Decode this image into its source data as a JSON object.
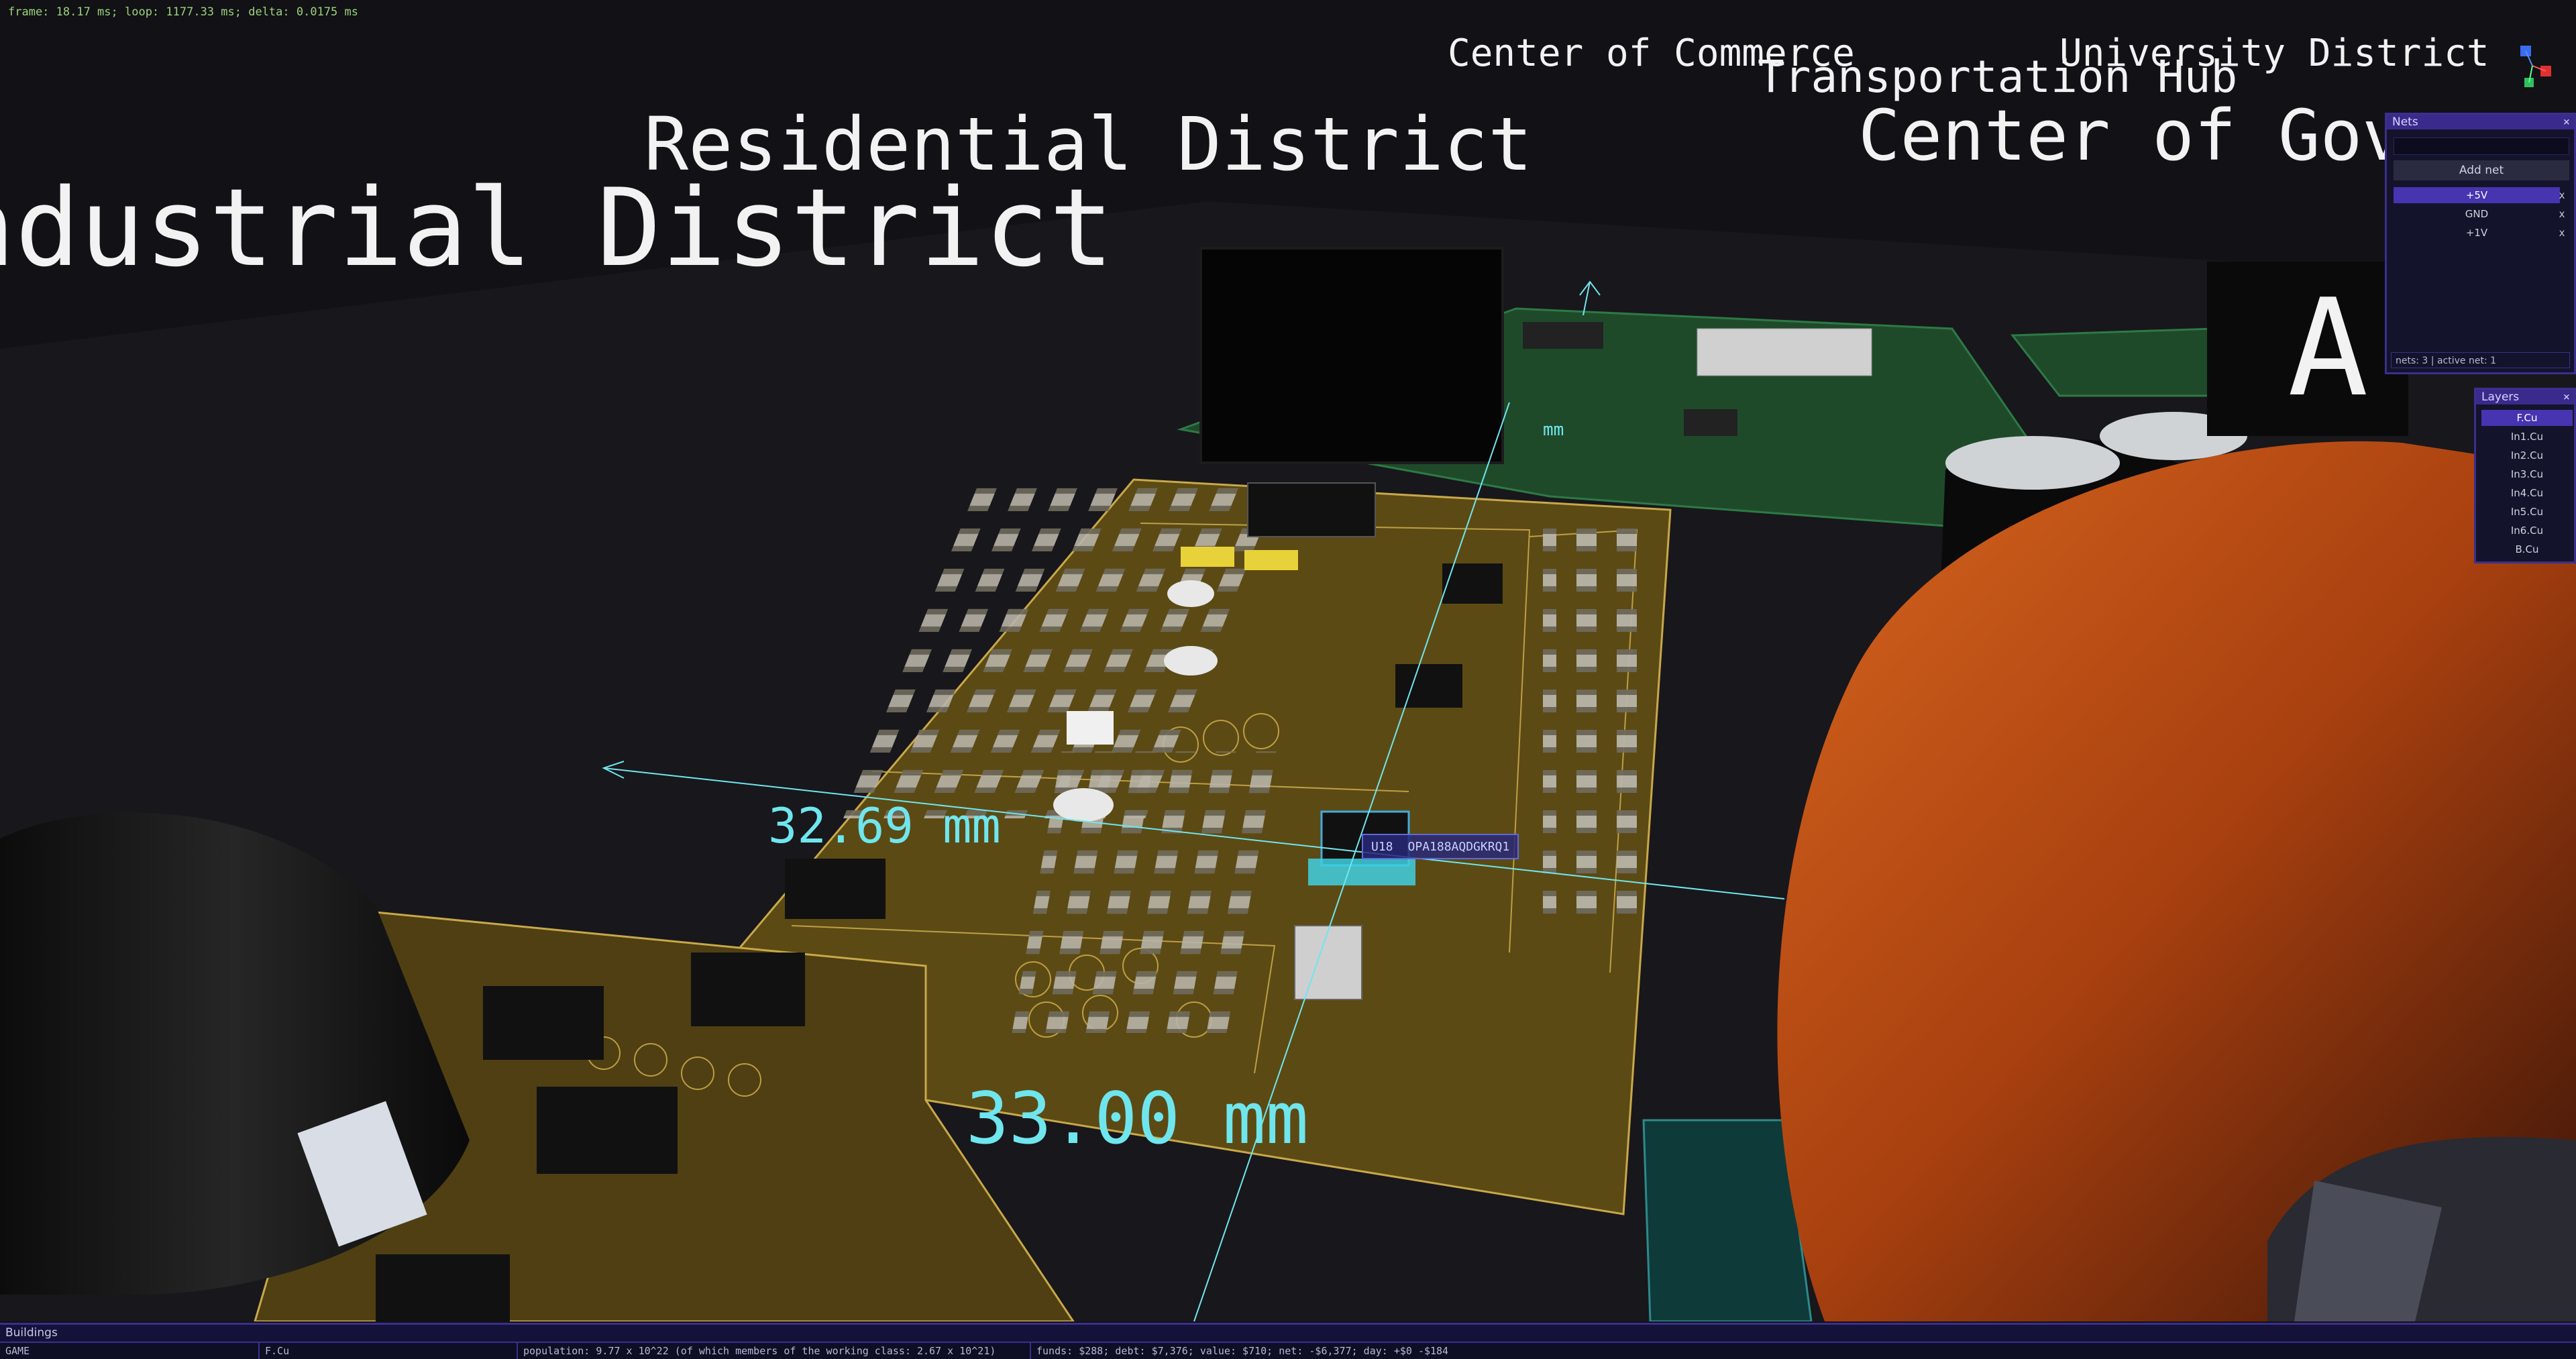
{
  "perf": "frame: 18.17 ms; loop: 1177.33 ms; delta: 0.0175 ms",
  "districts": {
    "industrial": "Industrial District",
    "residential": "Residential District",
    "commerce": "Center of Commerce",
    "university": "University District",
    "transportation": "Transportation Hub",
    "government": "Center of Gov",
    "partial": "A"
  },
  "dimensions": {
    "top_small": "mm",
    "mid": "32.69 mm",
    "bottom": "33.00 mm"
  },
  "selected_component": {
    "ref": "U18",
    "part": "OPA188AQDGKRQ1"
  },
  "nets_panel": {
    "title": "Nets",
    "close": "×",
    "add_net": "Add net",
    "nets": [
      {
        "name": "+5V",
        "active": true,
        "remove": "x"
      },
      {
        "name": "GND",
        "active": false,
        "remove": "x"
      },
      {
        "name": "+1V",
        "active": false,
        "remove": "x"
      }
    ],
    "status": "nets: 3 | active net: 1"
  },
  "layers_panel": {
    "title": "Layers",
    "close": "×",
    "layers": [
      "F.Cu",
      "In1.Cu",
      "In2.Cu",
      "In3.Cu",
      "In4.Cu",
      "In5.Cu",
      "In6.Cu",
      "B.Cu"
    ],
    "active": "F.Cu"
  },
  "buildings_bar": "Buildings",
  "status_bar": {
    "mode": "GAME",
    "layer": "F.Cu",
    "population": "population: 9.77 x 10^22 (of which members of the working class: 2.67 x 10^21)",
    "economy": "funds: $288; debt: $7,376; value: $710; net: -$6,377; day: +$0 -$184"
  },
  "colors": {
    "board_gold": "#5c4a14",
    "board_green": "#1f4a2a",
    "silkscreen": "#c8a84a",
    "dimension_cyan": "#6fe6ee",
    "panel_accent": "#3b2f8e",
    "active_row": "#4634b0",
    "orange_object": "#c4541c"
  }
}
